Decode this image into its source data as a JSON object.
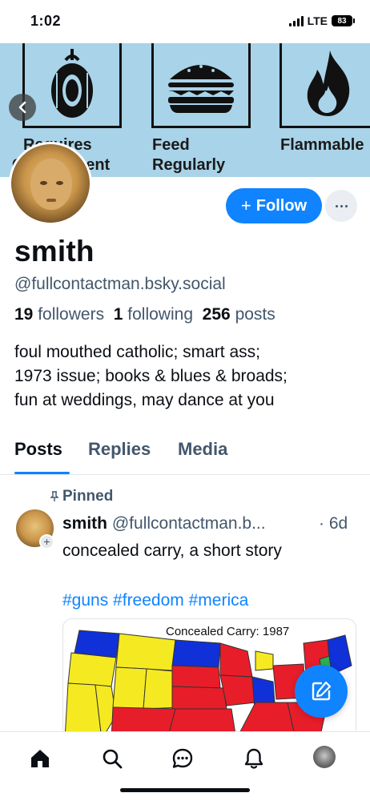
{
  "status": {
    "time": "1:02",
    "network": "LTE",
    "battery": "83"
  },
  "banner": {
    "label_left_1": "Requires",
    "label_left_2": "Containment",
    "label_mid_1": "Feed",
    "label_mid_2": "Regularly",
    "label_right": "Flammable"
  },
  "profile": {
    "follow_label": "Follow",
    "display_name": "smith",
    "handle": "@fullcontactman.bsky.social",
    "followers_count": "19",
    "followers_label": "followers",
    "following_count": "1",
    "following_label": "following",
    "posts_count": "256",
    "posts_label": "posts",
    "bio_line1": "foul mouthed catholic; smart ass;",
    "bio_line2": "1973 issue; books & blues & broads;",
    "bio_line3": "fun at weddings, may dance at you"
  },
  "tabs": [
    {
      "label": "Posts",
      "active": true
    },
    {
      "label": "Replies",
      "active": false
    },
    {
      "label": "Media",
      "active": false
    }
  ],
  "post": {
    "pinned_label": "Pinned",
    "author_name": "smith",
    "author_handle": "@fullcontactman.b...",
    "time": "· 6d",
    "text": "concealed carry, a short story",
    "tags": "#guns #freedom #merica",
    "image_title": "Concealed Carry: 1987"
  },
  "nav": [
    "home-icon",
    "search-icon",
    "chat-icon",
    "bell-icon",
    "profile-avatar"
  ],
  "colors": {
    "accent": "#1083fe",
    "muted": "#42576c",
    "banner": "#a9d3e8"
  }
}
